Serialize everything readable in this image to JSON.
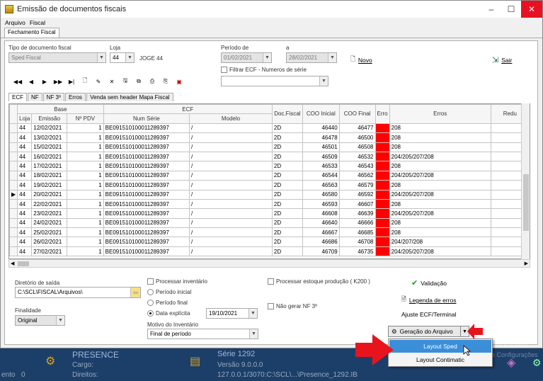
{
  "window": {
    "title": "Emissão de documentos fiscais",
    "minimize": "–",
    "maximize": "☐",
    "close": "✕"
  },
  "menu": [
    "Arquivo",
    "Fiscal"
  ],
  "top_tab": "Fechamento Fiscal",
  "form": {
    "tipo_label": "Tipo de documento fiscal",
    "tipo_value": "Sped Fiscal",
    "loja_label": "Loja",
    "loja_value": "44",
    "loja_name": "JOGE 44",
    "periodo_label": "Período  de",
    "periodo_de": "01/02/2021",
    "a_label": "a",
    "periodo_ate": "28/02/2021",
    "filtrar_label": "Filtrar ECF - Numeros de série",
    "novo_label": "Novo",
    "sair_label": "Sair"
  },
  "grid_tabs": [
    "ECF",
    "NF",
    "NF 3º",
    "Erros",
    "Venda sem header Mapa Fiscal"
  ],
  "grid": {
    "group_base": "Base",
    "group_ecf": "ECF",
    "headers": {
      "loja": "Loja",
      "emissao": "Emissão",
      "npdv": "Nº PDV",
      "serie": "Num Série",
      "modelo": "Modelo",
      "doc": "Doc.Fiscal",
      "cooi": "COO Inicial",
      "coof": "COO Final",
      "erro": "Erro",
      "erros": "Erros",
      "redu": "Redu"
    },
    "rows": [
      {
        "loja": "44",
        "emissao": "12/02/2021",
        "pdv": "1",
        "serie": "BE091510100011289397",
        "modelo": "/",
        "doc": "2D",
        "cooi": "46440",
        "coof": "46477",
        "erros": "208"
      },
      {
        "loja": "44",
        "emissao": "13/02/2021",
        "pdv": "1",
        "serie": "BE091510100011289397",
        "modelo": "/",
        "doc": "2D",
        "cooi": "46478",
        "coof": "46500",
        "erros": "208"
      },
      {
        "loja": "44",
        "emissao": "15/02/2021",
        "pdv": "1",
        "serie": "BE091510100011289397",
        "modelo": "/",
        "doc": "2D",
        "cooi": "46501",
        "coof": "46508",
        "erros": "208"
      },
      {
        "loja": "44",
        "emissao": "16/02/2021",
        "pdv": "1",
        "serie": "BE091510100011289397",
        "modelo": "/",
        "doc": "2D",
        "cooi": "46509",
        "coof": "46532",
        "erros": "204/205/207/208"
      },
      {
        "loja": "44",
        "emissao": "17/02/2021",
        "pdv": "1",
        "serie": "BE091510100011289397",
        "modelo": "/",
        "doc": "2D",
        "cooi": "46533",
        "coof": "46543",
        "erros": "208"
      },
      {
        "loja": "44",
        "emissao": "18/02/2021",
        "pdv": "1",
        "serie": "BE091510100011289397",
        "modelo": "/",
        "doc": "2D",
        "cooi": "46544",
        "coof": "46562",
        "erros": "204/205/207/208"
      },
      {
        "loja": "44",
        "emissao": "19/02/2021",
        "pdv": "1",
        "serie": "BE091510100011289397",
        "modelo": "/",
        "doc": "2D",
        "cooi": "46563",
        "coof": "46579",
        "erros": "208"
      },
      {
        "loja": "44",
        "emissao": "20/02/2021",
        "pdv": "1",
        "serie": "BE091510100011289397",
        "modelo": "/",
        "doc": "2D",
        "cooi": "46580",
        "coof": "46592",
        "erros": "204/205/207/208"
      },
      {
        "loja": "44",
        "emissao": "22/02/2021",
        "pdv": "1",
        "serie": "BE091510100011289397",
        "modelo": "/",
        "doc": "2D",
        "cooi": "46593",
        "coof": "46607",
        "erros": "208"
      },
      {
        "loja": "44",
        "emissao": "23/02/2021",
        "pdv": "1",
        "serie": "BE091510100011289397",
        "modelo": "/",
        "doc": "2D",
        "cooi": "46608",
        "coof": "46639",
        "erros": "204/205/207/208"
      },
      {
        "loja": "44",
        "emissao": "24/02/2021",
        "pdv": "1",
        "serie": "BE091510100011289397",
        "modelo": "/",
        "doc": "2D",
        "cooi": "46640",
        "coof": "46666",
        "erros": "208"
      },
      {
        "loja": "44",
        "emissao": "25/02/2021",
        "pdv": "1",
        "serie": "BE091510100011289397",
        "modelo": "/",
        "doc": "2D",
        "cooi": "46667",
        "coof": "46685",
        "erros": "208"
      },
      {
        "loja": "44",
        "emissao": "26/02/2021",
        "pdv": "1",
        "serie": "BE091510100011289397",
        "modelo": "/",
        "doc": "2D",
        "cooi": "46686",
        "coof": "46708",
        "erros": "204/207/208"
      },
      {
        "loja": "44",
        "emissao": "27/02/2021",
        "pdv": "1",
        "serie": "BE091510100011289397",
        "modelo": "/",
        "doc": "2D",
        "cooi": "46709",
        "coof": "46735",
        "erros": "204/205/207/208"
      }
    ],
    "current_row_marker": "▶"
  },
  "bottom": {
    "diretorio_label": "Diretório de saída",
    "diretorio_value": "C:\\SCL\\FISCAL\\Arquivos\\",
    "finalidade_label": "Finalidade",
    "finalidade_value": "Original",
    "processar_inv": "Processar inventário",
    "periodo_inicial": "Período inicial",
    "periodo_final": "Período final",
    "data_explicita": "Data explícita",
    "data_value": "19/10/2021",
    "motivo_label": "Motivo do Inventário",
    "motivo_value": "Final de período",
    "processar_estoque": "Processar estoque produção ( K200 )",
    "nao_gerar": "Não gerar NF 3º",
    "validacao": "Validação",
    "legenda": "Legenda de erros",
    "ajuste": "Ajuste ECF/Terminal",
    "geracao": "Geração do Arquivo"
  },
  "popup": {
    "item1": "Layout Sped",
    "item2": "Layout Contimatic"
  },
  "taskbar": {
    "presence": "PRESENCE",
    "cargo": "Cargo:",
    "direitos": "Direitos:",
    "serie": "Série  1292",
    "versao": "Versão   9.0.0.0",
    "path": "127.0.0.1/3070:C:\\SCL\\...\\Presence_1292.IB",
    "left_text": "ento",
    "left_num": "0",
    "watermark1": "Windows",
    "watermark2": "esse Configurações"
  },
  "colors": {
    "error_red": "#ff0000",
    "arrow_red": "#e8141c",
    "highlight": "#3b8ed8"
  }
}
